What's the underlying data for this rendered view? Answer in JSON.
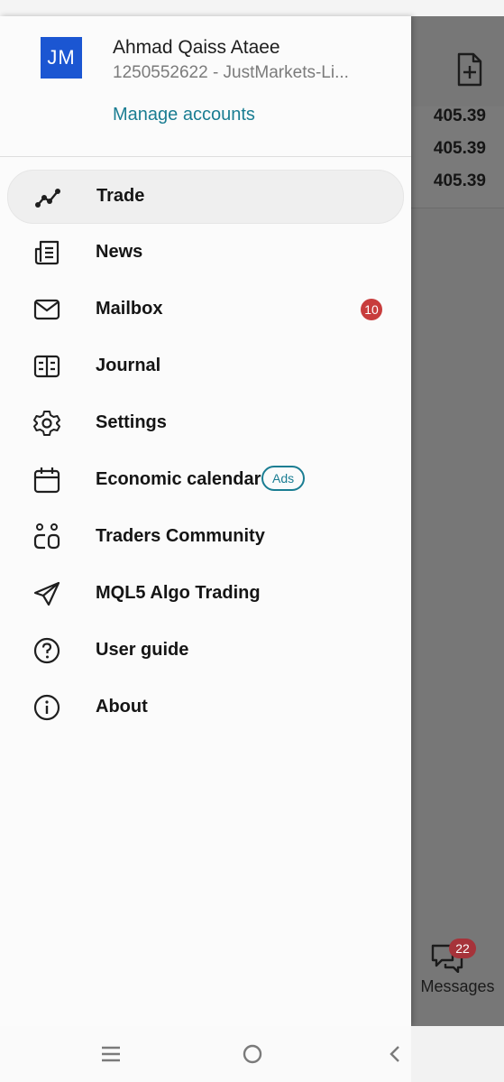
{
  "account": {
    "initials": "JM",
    "name": "Ahmad Qaiss Ataee",
    "subtitle": "1250552622 - JustMarkets-Li...",
    "manage_label": "Manage accounts"
  },
  "menu": [
    {
      "label": "Trade",
      "icon": "trade-chart-icon",
      "active": true
    },
    {
      "label": "News",
      "icon": "news-icon"
    },
    {
      "label": "Mailbox",
      "icon": "mail-icon",
      "badge": "10"
    },
    {
      "label": "Journal",
      "icon": "journal-icon"
    },
    {
      "label": "Settings",
      "icon": "gear-icon"
    },
    {
      "label": "Economic calendar",
      "icon": "calendar-icon",
      "tag": "Ads"
    },
    {
      "label": "Traders Community",
      "icon": "community-icon"
    },
    {
      "label": "MQL5 Algo Trading",
      "icon": "send-icon"
    },
    {
      "label": "User guide",
      "icon": "help-icon"
    },
    {
      "label": "About",
      "icon": "info-icon"
    }
  ],
  "background": {
    "prices": [
      "405.39",
      "405.39",
      "405.39"
    ],
    "messages_label": "Messages",
    "messages_badge": "22"
  },
  "colors": {
    "accent": "#1a7d92",
    "avatar_bg": "#1b56d2",
    "badge_red": "#c83d3d"
  }
}
